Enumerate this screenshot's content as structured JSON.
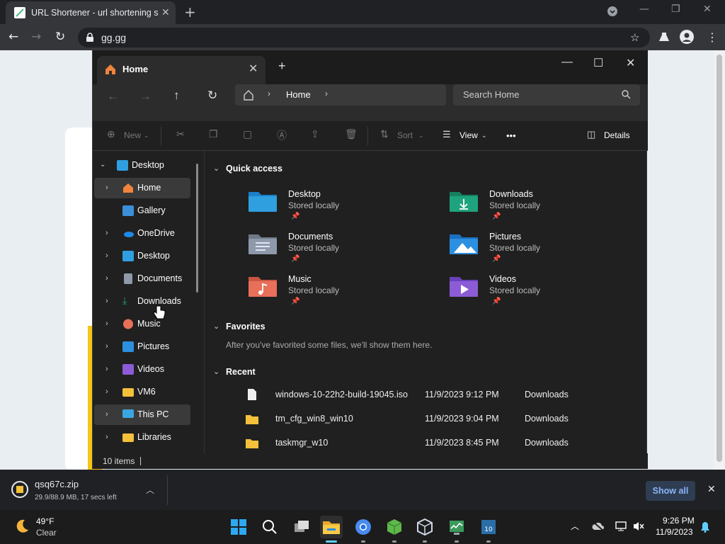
{
  "browser": {
    "tab_title": "URL Shortener - url shortening se",
    "url": "gg.gg"
  },
  "explorer": {
    "tab_title": "Home",
    "breadcrumb": [
      "Home"
    ],
    "search_placeholder": "Search Home",
    "toolbar": {
      "new": "New",
      "sort": "Sort",
      "view": "View",
      "more": "•••",
      "details": "Details"
    },
    "sidebar": [
      {
        "label": "Desktop",
        "icon": "desktop-icon",
        "expanded": true
      },
      {
        "label": "Home",
        "icon": "home-icon",
        "selected": true
      },
      {
        "label": "Gallery",
        "icon": "gallery-icon"
      },
      {
        "label": "OneDrive",
        "icon": "onedrive-icon"
      },
      {
        "label": "Desktop",
        "icon": "desktop-icon"
      },
      {
        "label": "Documents",
        "icon": "documents-icon"
      },
      {
        "label": "Downloads",
        "icon": "downloads-icon"
      },
      {
        "label": "Music",
        "icon": "music-icon"
      },
      {
        "label": "Pictures",
        "icon": "pictures-icon"
      },
      {
        "label": "Videos",
        "icon": "videos-icon"
      },
      {
        "label": "VM6",
        "icon": "folder-icon"
      },
      {
        "label": "This PC",
        "icon": "this-pc-icon",
        "highlighted": true
      },
      {
        "label": "Libraries",
        "icon": "libraries-icon"
      }
    ],
    "quick_access": {
      "title": "Quick access",
      "items": [
        {
          "name": "Desktop",
          "status": "Stored locally",
          "color": "#2f9fe0"
        },
        {
          "name": "Downloads",
          "status": "Stored locally",
          "color": "#1fa37e"
        },
        {
          "name": "Documents",
          "status": "Stored locally",
          "color": "#8e9aaa"
        },
        {
          "name": "Pictures",
          "status": "Stored locally",
          "color": "#2d8fe0"
        },
        {
          "name": "Music",
          "status": "Stored locally",
          "color": "#e8705a"
        },
        {
          "name": "Videos",
          "status": "Stored locally",
          "color": "#8b5cd6"
        }
      ]
    },
    "favorites": {
      "title": "Favorites",
      "empty_text": "After you've favorited some files, we'll show them here."
    },
    "recent": {
      "title": "Recent",
      "items": [
        {
          "name": "windows-10-22h2-build-19045.iso",
          "date": "11/9/2023 9:12 PM",
          "location": "Downloads",
          "type": "file"
        },
        {
          "name": "tm_cfg_win8_win10",
          "date": "11/9/2023 9:04 PM",
          "location": "Downloads",
          "type": "folder"
        },
        {
          "name": "taskmgr_w10",
          "date": "11/9/2023 8:45 PM",
          "location": "Downloads",
          "type": "folder"
        }
      ]
    },
    "status": "10 items"
  },
  "download": {
    "file": "qsq67c.zip",
    "progress_text": "29.9/88.9 MB, 17 secs left",
    "show_all": "Show all"
  },
  "taskbar": {
    "weather_temp": "49°F",
    "weather_desc": "Clear",
    "time": "9:26 PM",
    "date": "11/9/2023"
  }
}
